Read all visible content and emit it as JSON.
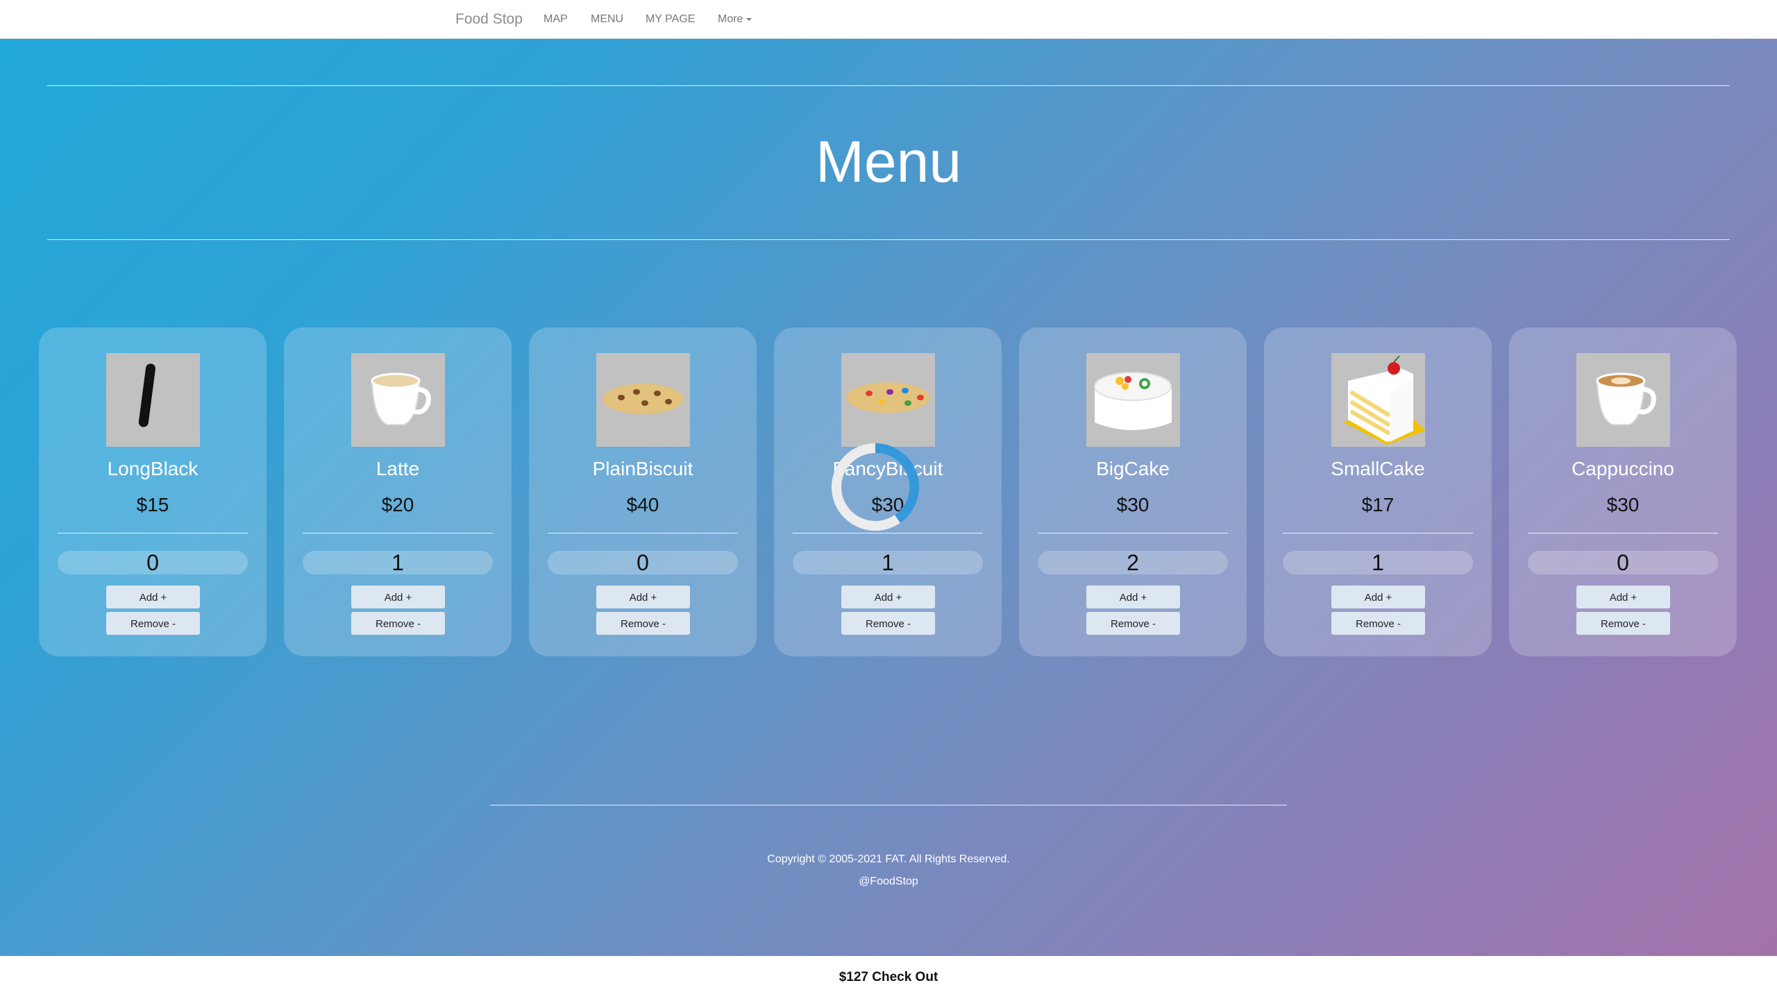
{
  "nav": {
    "brand": "Food Stop",
    "links": [
      "MAP",
      "MENU",
      "MY PAGE"
    ],
    "more": "More"
  },
  "page_title": "Menu",
  "items": [
    {
      "name": "LongBlack",
      "price": "$15",
      "qty": "0",
      "add": "Add +",
      "remove": "Remove -",
      "icon": "long-black-icon"
    },
    {
      "name": "Latte",
      "price": "$20",
      "qty": "1",
      "add": "Add +",
      "remove": "Remove -",
      "icon": "latte-cup-icon"
    },
    {
      "name": "PlainBiscuit",
      "price": "$40",
      "qty": "0",
      "add": "Add +",
      "remove": "Remove -",
      "icon": "plain-biscuit-icon"
    },
    {
      "name": "FancyBiscuit",
      "price": "$30",
      "qty": "1",
      "add": "Add +",
      "remove": "Remove -",
      "icon": "fancy-biscuit-icon"
    },
    {
      "name": "BigCake",
      "price": "$30",
      "qty": "2",
      "add": "Add +",
      "remove": "Remove -",
      "icon": "big-cake-icon"
    },
    {
      "name": "SmallCake",
      "price": "$17",
      "qty": "1",
      "add": "Add +",
      "remove": "Remove -",
      "icon": "cake-slice-icon"
    },
    {
      "name": "Cappuccino",
      "price": "$30",
      "qty": "0",
      "add": "Add +",
      "remove": "Remove -",
      "icon": "cappuccino-cup-icon"
    }
  ],
  "footer": {
    "copyright": "Copyright © 2005-2021 FAT. All Rights Reserved.",
    "handle": "@FoodStop"
  },
  "checkout": "$127 Check Out",
  "colors": {
    "gradient_start": "#22a9da",
    "gradient_end": "#a771a9",
    "spinner": "#3498db"
  }
}
